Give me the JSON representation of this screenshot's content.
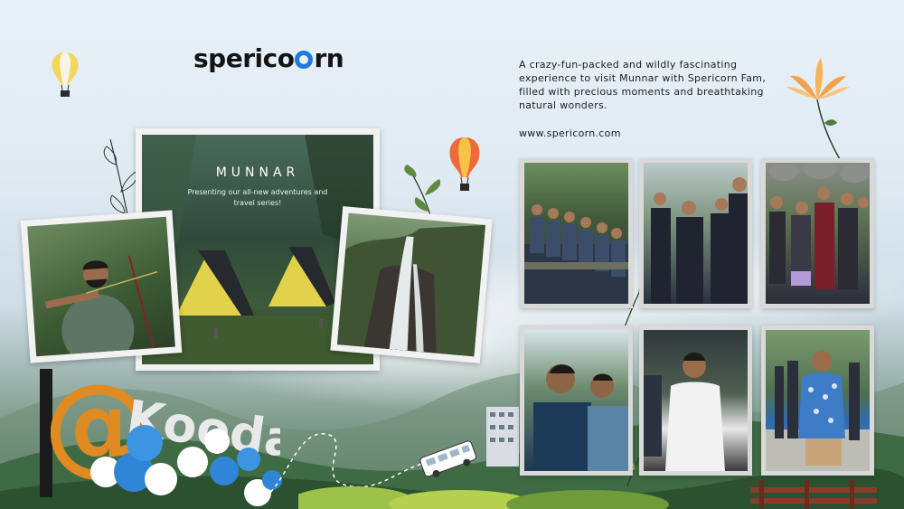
{
  "brand": {
    "logo_prefix": "sperico",
    "logo_suffix": "rn",
    "accent_color": "#1e7bd6"
  },
  "intro": {
    "tagline": "A crazy-fun-packed and wildly fascinating experience to visit Munnar with Spericorn Fam, filled with precious moments and breathtaking natural wonders.",
    "website": "www.spericorn.com"
  },
  "feature": {
    "title": "MUNNAR",
    "subtitle": "Presenting our all-new adventures and travel series!"
  },
  "sign": {
    "text": "Koodaram",
    "mark": "@"
  },
  "icons": [
    "hot-air-balloon-icon",
    "flower-icon",
    "leaf-icon",
    "bus-icon"
  ]
}
